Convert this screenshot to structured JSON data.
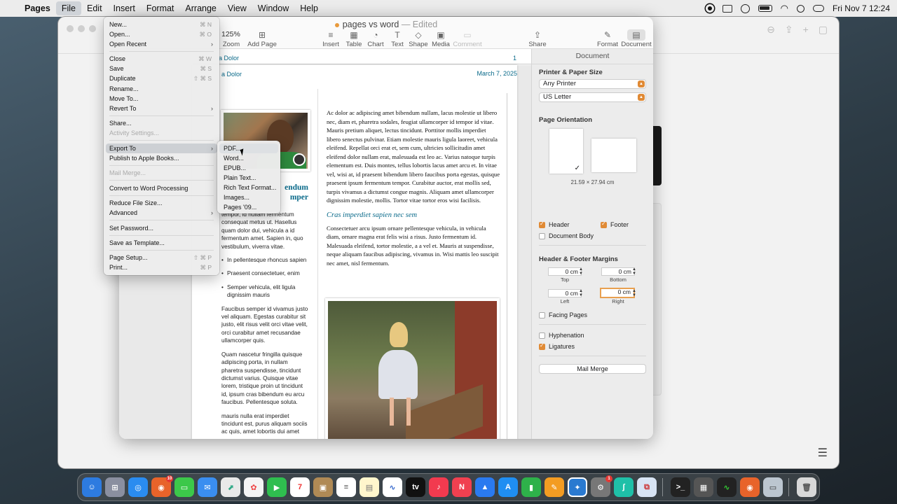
{
  "menubar": {
    "app": "Pages",
    "items": [
      "File",
      "Edit",
      "Insert",
      "Format",
      "Arrange",
      "View",
      "Window",
      "Help"
    ],
    "clock": "Fri Nov 7  12:24"
  },
  "window": {
    "title": "pages vs word",
    "edited": "Edited"
  },
  "toolbar": {
    "zoom_value": "125%",
    "zoom": "Zoom",
    "add_page": "Add Page",
    "insert": "Insert",
    "table": "Table",
    "chart": "Chart",
    "text": "Text",
    "shape": "Shape",
    "media": "Media",
    "comment": "Comment",
    "share": "Share",
    "format": "Format",
    "document": "Document"
  },
  "page": {
    "ruler_header": "a Dolor",
    "ruler_page": "1",
    "header_text": "a Dolor",
    "date": "March 7, 2025",
    "headline": "endum\nmper",
    "col_a": {
      "p1": "tempor, id nullam fermentum consequat metus ut. Hasellus quam dolor dui, vehicula a id fermentum amet. Sapien in, quo vestibulum, viverra vitae.",
      "bullets": [
        "In pellentesque rhoncus sapien",
        "Praesent consectetuer, enim",
        "Semper vehicula, elit ligula dignissim mauris"
      ],
      "p2": "Faucibus semper id vivamus justo vel aliquam. Egestas curabitur sit justo, elit risus velit orci vitae velit, orci curabitur amet recusandae ullamcorper quis.",
      "p3": "Quam nascetur fringilla quisque adipiscing porta, in nullam pharetra suspendisse, tincidunt dictumst varius. Quisque vitae lorem, tristique proin ut tincidunt id, ipsum cras bibendum eu arcu faucibus. Pellentesque soluta.",
      "p4": "mauris nulla erat imperdiet tincidunt est, purus aliquam sociis ac quis, amet lobortis dui amet"
    },
    "col_b": {
      "p1": "Ac dolor ac adipiscing amet bibendum nullam, lacus molestie ut libero nec, diam et, pharetra sodales, feugiat ullamcorper id tempor id vitae. Mauris pretium aliquet, lectus tincidunt. Porttitor mollis imperdiet libero senectus pulvinar. Etiam molestie mauris ligula laoreet, vehicula eleifend. Repellat orci erat et, sem cum, ultricies sollicitudin amet eleifend dolor nullam erat, malesuada est leo ac. Varius natoque turpis elementum est. Duis montes, tellus lobortis lacus amet arcu et. In vitae vel, wisi at, id praesent bibendum libero faucibus porta egestas, quisque praesent ipsum fermentum tempor. Curabitur auctor, erat mollis sed, turpis vivamus a dictumst congue magnis. Aliquam amet ullamcorper dignissim molestie, mollis. Tortor vitae tortor eros wisi facilisis.",
      "heading": "Cras imperdiet sapien nec sem",
      "p2": "Consectetuer arcu ipsum ornare pellentesque vehicula, in vehicula diam, ornare magna erat felis wisi a risus. Justo fermentum id. Malesuada eleifend, tortor molestie, a a vel et. Mauris at suspendisse, neque aliquam faucibus adipiscing, vivamus in. Wisi mattis leo suscipit nec amet, nisl fermentum."
    }
  },
  "inspector": {
    "title": "Document",
    "printer_section": "Printer & Paper Size",
    "printer": "Any Printer",
    "paper": "US Letter",
    "orientation_section": "Page Orientation",
    "paper_dims": "21.59 × 27.94 cm",
    "header": "Header",
    "footer": "Footer",
    "document_body": "Document Body",
    "margins_section": "Header & Footer Margins",
    "top_value": "0 cm",
    "top": "Top",
    "bottom_value": "0 cm",
    "bottom": "Bottom",
    "left_value": "0 cm",
    "left": "Left",
    "right_value": "0 cm",
    "right": "Right",
    "facing_pages": "Facing Pages",
    "hyphenation": "Hyphenation",
    "ligatures": "Ligatures",
    "mail_merge": "Mail Merge",
    "checks": {
      "header": true,
      "footer": true,
      "document_body": false,
      "facing_pages": false,
      "hyphenation": false,
      "ligatures": true
    }
  },
  "file_menu": {
    "new": "New...",
    "new_sc": "⌘ N",
    "open": "Open...",
    "open_sc": "⌘ O",
    "open_recent": "Open Recent",
    "close": "Close",
    "close_sc": "⌘ W",
    "save": "Save",
    "save_sc": "⌘ S",
    "duplicate": "Duplicate",
    "duplicate_sc": "⇧ ⌘ S",
    "rename": "Rename...",
    "move_to": "Move To...",
    "revert_to": "Revert To",
    "share": "Share...",
    "activity": "Activity Settings...",
    "export_to": "Export To",
    "publish": "Publish to Apple Books...",
    "mail_merge": "Mail Merge...",
    "convert": "Convert to Word Processing",
    "reduce": "Reduce File Size...",
    "advanced": "Advanced",
    "set_password": "Set Password...",
    "save_template": "Save as Template...",
    "page_setup": "Page Setup...",
    "page_setup_sc": "⇧ ⌘ P",
    "print": "Print...",
    "print_sc": "⌘ P"
  },
  "export_submenu": [
    "PDF...",
    "Word...",
    "EPUB...",
    "Plain Text...",
    "Rich Text Format...",
    "Images...",
    "Pages '09..."
  ],
  "dock": {
    "badge_firefox": "10",
    "badge_settings": "1"
  }
}
